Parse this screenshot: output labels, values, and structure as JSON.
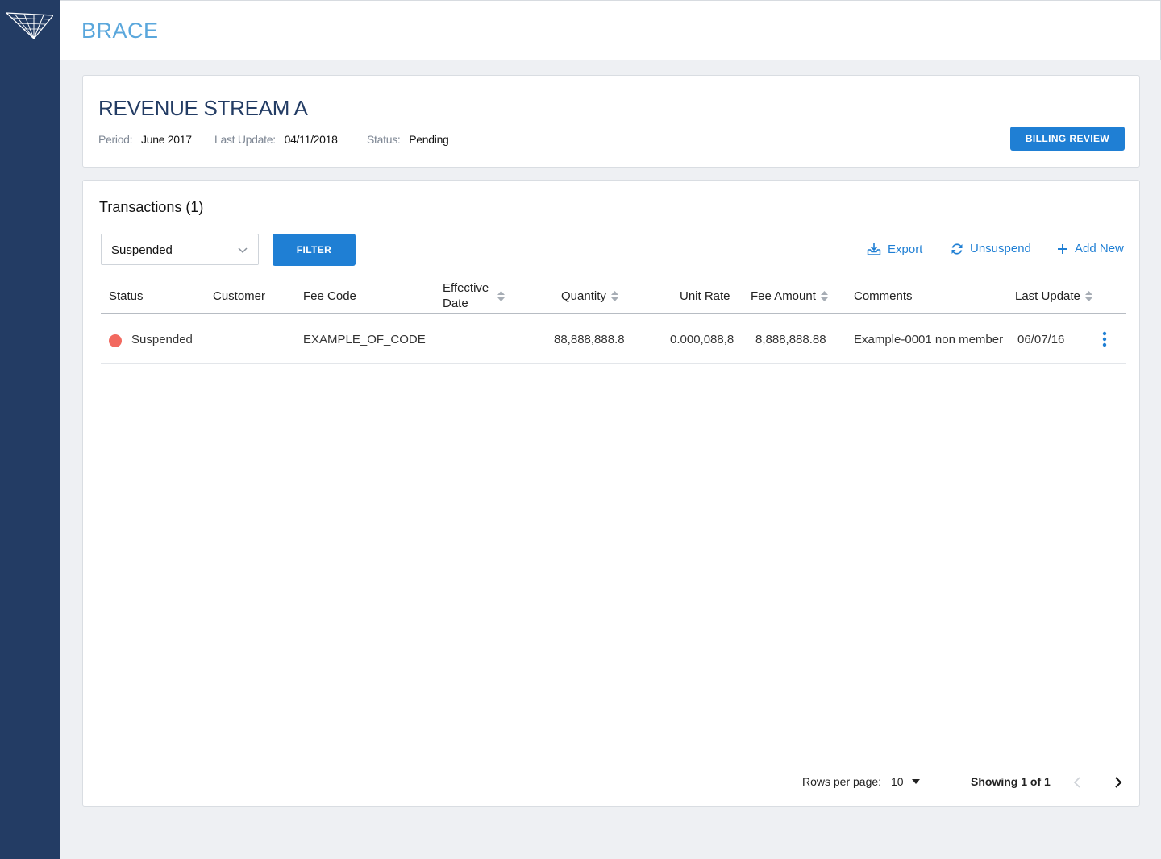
{
  "app": {
    "brand": "BRACE"
  },
  "header": {
    "title": "REVENUE STREAM A",
    "period_label": "Period:",
    "period_value": "June 2017",
    "last_update_label": "Last Update:",
    "last_update_value": "04/11/2018",
    "status_label": "Status:",
    "status_value": "Pending",
    "billing_button": "BILLING REVIEW"
  },
  "transactions": {
    "title": "Transactions (1)",
    "filter_select_value": "Suspended",
    "filter_button": "FILTER",
    "actions": {
      "export": "Export",
      "unsuspend": "Unsuspend",
      "add_new": "Add New"
    },
    "columns": {
      "status": "Status",
      "customer": "Customer",
      "fee_code": "Fee Code",
      "effective_date_1": "Effective",
      "effective_date_2": "Date",
      "quantity": "Quantity",
      "unit_rate": "Unit Rate",
      "fee_amount": "Fee Amount",
      "comments": "Comments",
      "last_update": "Last Update"
    },
    "rows": [
      {
        "status": "Suspended",
        "status_color": "#f2695f",
        "customer": "",
        "fee_code": "EXAMPLE_OF_CODE",
        "effective_date": "",
        "quantity": "88,888,888.8",
        "unit_rate": "0.000,088,8",
        "fee_amount": "8,888,888.88",
        "comments": "Example-0001 non member",
        "last_update": "06/07/16"
      }
    ],
    "pagination": {
      "rows_per_page_label": "Rows per page:",
      "rows_per_page_value": "10",
      "showing": "Showing 1 of 1"
    }
  },
  "colors": {
    "sidebar": "#233c64",
    "accent": "#1f7fd4",
    "brand": "#5aa7dc",
    "suspended": "#f2695f"
  }
}
